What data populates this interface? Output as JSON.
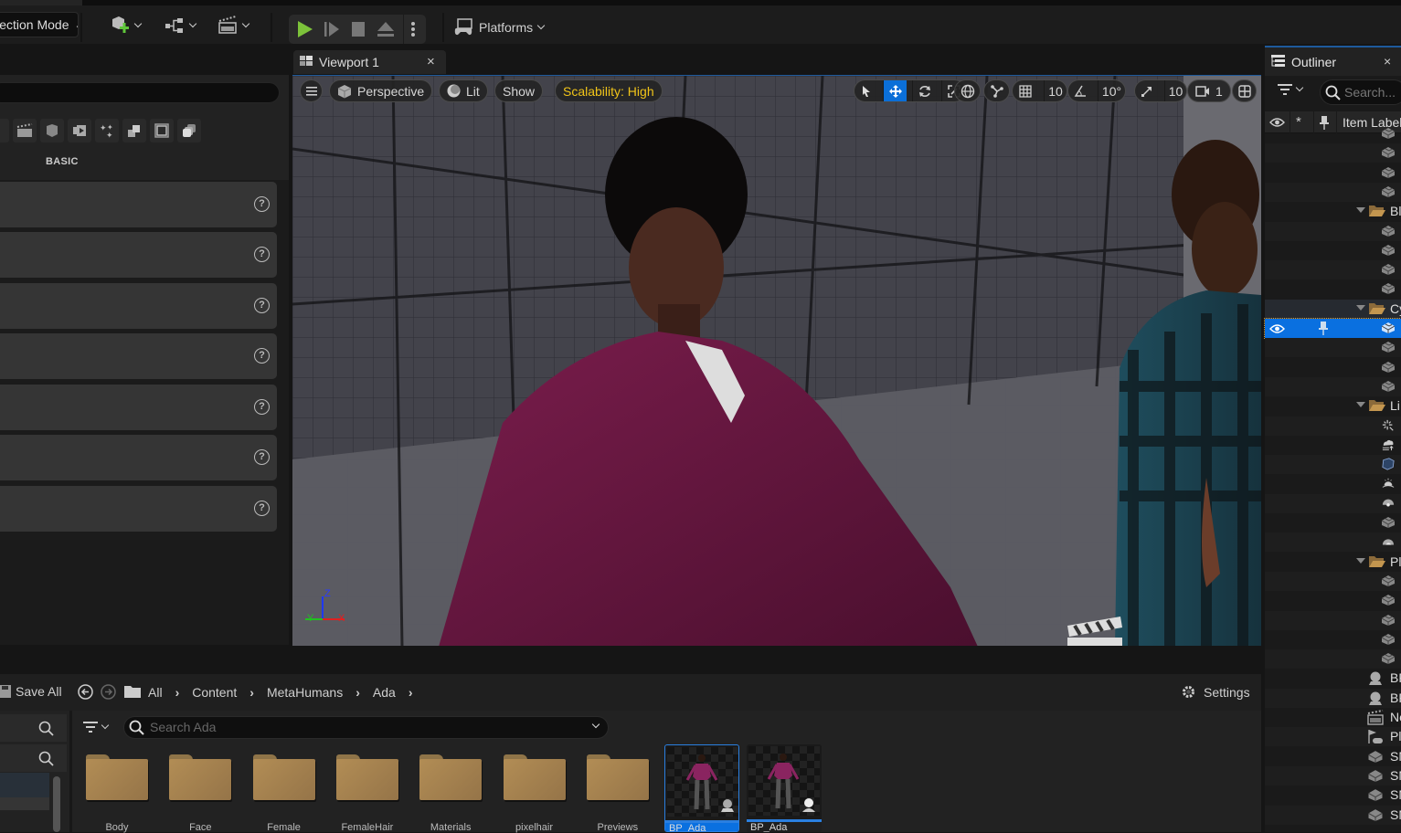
{
  "toolbar": {
    "mode_label": "Selection Mode",
    "platforms_label": "Platforms",
    "icons": [
      "add-actor-icon",
      "blueprint-icon",
      "cinematics-icon"
    ],
    "play_controls": [
      "play-icon",
      "advance-frame-icon",
      "stop-icon",
      "eject-icon",
      "more-options-icon"
    ],
    "play_color": "#7cc23a"
  },
  "left_panel": {
    "search_placeholder": "",
    "category_icons": [
      "cinematic-icon",
      "shape-icon",
      "media-icon",
      "visual-effects-icon",
      "geometry-icon",
      "volume-icon",
      "all-classes-icon"
    ],
    "tab_label": "BASIC",
    "items": [
      {
        "help": "?"
      },
      {
        "help": "?"
      },
      {
        "help": "?"
      },
      {
        "help": "?"
      },
      {
        "help": "?"
      },
      {
        "help": "?"
      },
      {
        "help": "?"
      }
    ]
  },
  "viewport": {
    "tab_label": "Viewport 1",
    "tab_close": "×",
    "perspective_label": "Perspective",
    "lit_label": "Lit",
    "show_label": "Show",
    "scalability_label": "Scalability: High",
    "scalability_color": "#f0c419",
    "grid_snap": "10",
    "rotation_snap": "10°",
    "scale_snap": "10",
    "camera_speed": "1",
    "axis_labels": {
      "z": "Z",
      "x": "X",
      "y": "Y"
    }
  },
  "outliner": {
    "title": "Outliner",
    "close": "×",
    "search_placeholder": "Search...",
    "column_label": "Item Label",
    "folders": [
      {
        "label": "Bl"
      },
      {
        "label": "Cy"
      },
      {
        "label": "Li"
      },
      {
        "label": "Pl"
      }
    ],
    "bottom_items": [
      "BP",
      "BP",
      "Ne",
      "Pl",
      "SM",
      "SM",
      "SM",
      "SM"
    ]
  },
  "content_browser": {
    "save_all": "Save All",
    "breadcrumb": [
      "All",
      "Content",
      "MetaHumans",
      "Ada"
    ],
    "settings_label": "Settings",
    "search_placeholder": "Search Ada",
    "folders": [
      "Body",
      "Face",
      "Female",
      "FemaleHair",
      "Materials",
      "pixelhair",
      "Previews"
    ],
    "assets": [
      {
        "label": "BP_Ada",
        "selected": true,
        "badge": "webcam-icon"
      },
      {
        "label": "BP_Ada",
        "selected": false,
        "badge": "metahuman-icon"
      }
    ]
  }
}
